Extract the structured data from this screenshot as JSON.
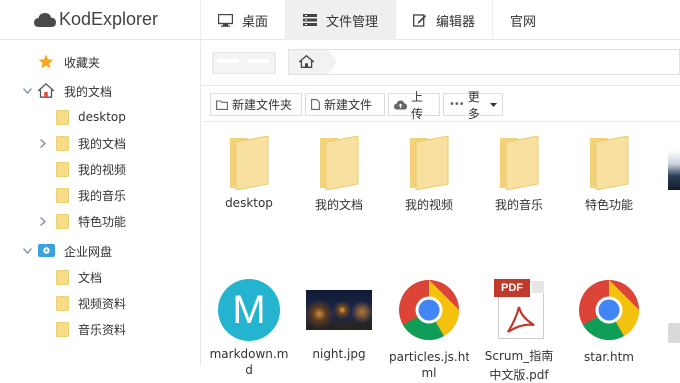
{
  "app": {
    "title": "KodExplorer"
  },
  "nav": [
    {
      "label": "桌面",
      "icon": "monitor-icon"
    },
    {
      "label": "文件管理",
      "icon": "list-icon",
      "active": true
    },
    {
      "label": "编辑器",
      "icon": "edit-icon"
    },
    {
      "label": "官网",
      "icon": ""
    }
  ],
  "sidebar": {
    "favorites": "收藏夹",
    "mydocs": "我的文档",
    "mydocs_children": [
      "desktop",
      "我的文档",
      "我的视频",
      "我的音乐",
      "特色功能"
    ],
    "cloud": "企业网盘",
    "cloud_children": [
      "文档",
      "视频资料",
      "音乐资料"
    ]
  },
  "toolbar": {
    "new_folder": "新建文件夹",
    "new_file": "新建文件",
    "upload": "上传",
    "more": "更多"
  },
  "files_row1": [
    "desktop",
    "我的文档",
    "我的视频",
    "我的音乐",
    "特色功能"
  ],
  "files_row2": [
    "markdown.m",
    "night.jpg",
    "particles.js.ht",
    "Scrum_指南",
    "star.htm"
  ],
  "files_row2_second_line": [
    "d",
    "",
    "ml",
    "中文版.pdf",
    ""
  ],
  "icons": {
    "markdown_letter": "M",
    "pdf_badge": "PDF"
  },
  "colors": {
    "folder": "#f7dd87",
    "markdown": "#25b4cf",
    "accent": "#2a7ae2"
  }
}
